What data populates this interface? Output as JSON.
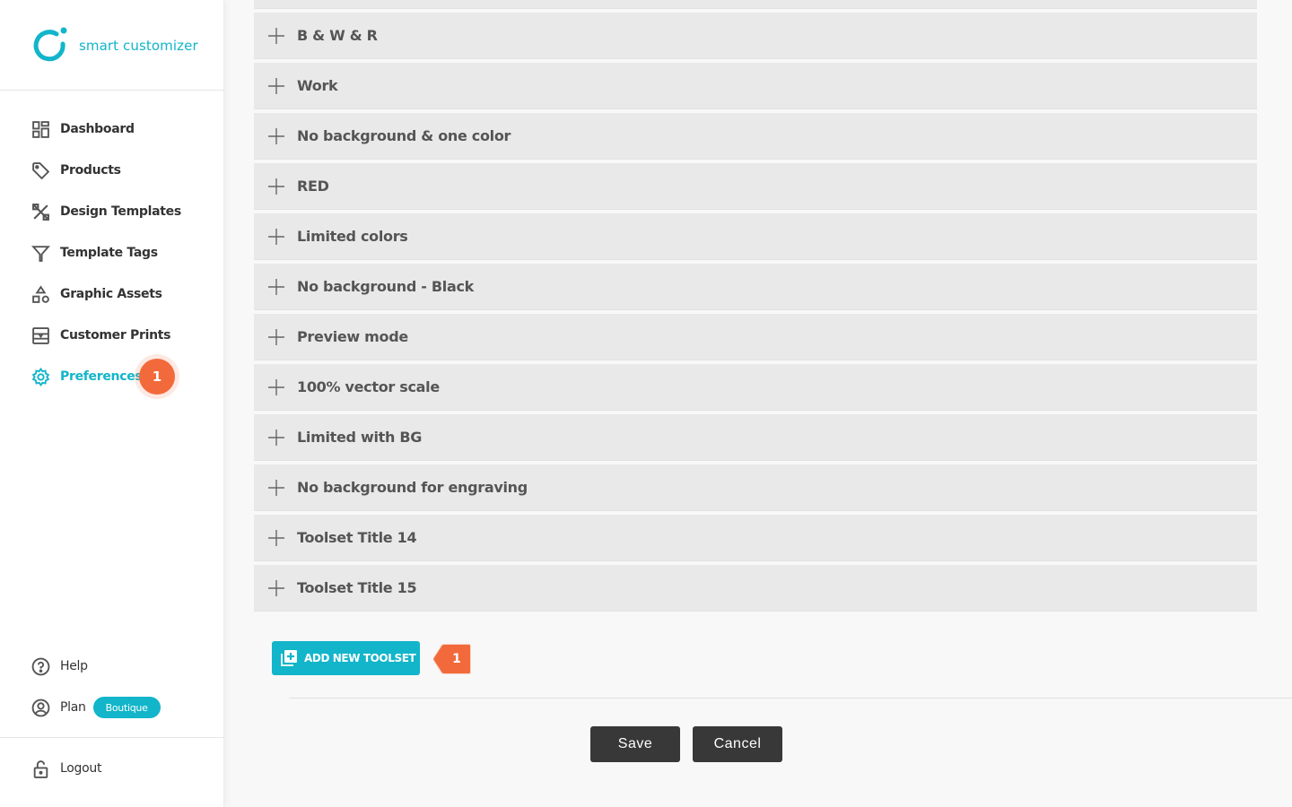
{
  "brand": {
    "name": "smart customizer",
    "accent": "#12b5c9"
  },
  "sidebar": {
    "items": [
      {
        "label": "Dashboard",
        "icon": "dashboard-icon"
      },
      {
        "label": "Products",
        "icon": "tag-icon"
      },
      {
        "label": "Design Templates",
        "icon": "design-tools-icon"
      },
      {
        "label": "Template Tags",
        "icon": "filter-icon"
      },
      {
        "label": "Graphic Assets",
        "icon": "shapes-icon"
      },
      {
        "label": "Customer Prints",
        "icon": "prints-icon"
      },
      {
        "label": "Preferences",
        "icon": "gear-icon",
        "active": true,
        "badge": "1"
      }
    ],
    "bottom": {
      "help": "Help",
      "plan": "Plan",
      "plan_badge": "Boutique",
      "logout": "Logout"
    }
  },
  "toolsets": [
    "B & W & R",
    "Work",
    "No background & one color",
    "RED",
    "Limited colors",
    "No background - Black",
    "Preview mode",
    "100% vector scale",
    "Limited with BG",
    "No background for engraving",
    "Toolset Title 14",
    "Toolset Title 15"
  ],
  "actions": {
    "add_toolset": "ADD NEW TOOLSET",
    "add_toolset_badge": "1",
    "save": "Save",
    "cancel": "Cancel"
  },
  "colors": {
    "badge": "#f26a3b",
    "button_dark": "#383838",
    "row_bg": "#e9e9e9"
  }
}
